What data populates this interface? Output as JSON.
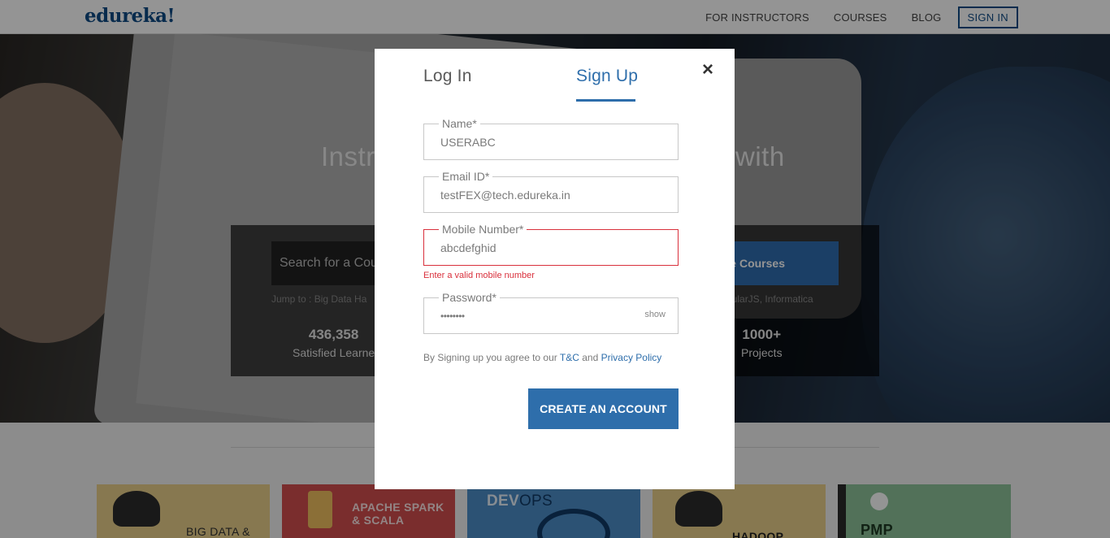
{
  "header": {
    "logo": "edureka!",
    "nav": [
      "FOR INSTRUCTORS",
      "COURSES",
      "BLOG"
    ],
    "signin": "SIGN IN"
  },
  "hero": {
    "title_left": "Instr",
    "title_right": "with",
    "search_placeholder": "Search for a Cou",
    "search_button": "e Courses",
    "jump_left": "Jump to : Big Data Ha",
    "jump_right": "gularJS, Informatica",
    "stats": [
      {
        "num": "436,358",
        "label": "Satisfied Learne"
      },
      {
        "num": "1000+",
        "label": "Projects"
      }
    ]
  },
  "cards": [
    {
      "title": "BIG DATA &"
    },
    {
      "title": "APACHE SPARK",
      "subtitle": "& SCALA"
    },
    {
      "title": "DEV",
      "title2": "OPS"
    },
    {
      "title": "HADOOP"
    },
    {
      "title": "PMP"
    }
  ],
  "modal": {
    "tabs": {
      "login": "Log In",
      "signup": "Sign Up"
    },
    "close": "×",
    "fields": {
      "name": {
        "label": "Name*",
        "value": "USERABC"
      },
      "email": {
        "label": "Email ID*",
        "value": "testFEX@tech.edureka.in"
      },
      "mobile": {
        "label": "Mobile Number*",
        "value": "abcdefghid",
        "error": "Enter a valid mobile number"
      },
      "password": {
        "label": "Password*",
        "value": "••••••••",
        "show": "show"
      }
    },
    "terms": {
      "prefix": "By Signing up you agree to our",
      "tc": "T&C",
      "and": "and",
      "privacy": "Privacy Policy"
    },
    "submit": "CREATE AN ACCOUNT"
  },
  "colors": {
    "brand": "#0e4a86",
    "accent": "#2e6eab",
    "error": "#d9303c"
  }
}
